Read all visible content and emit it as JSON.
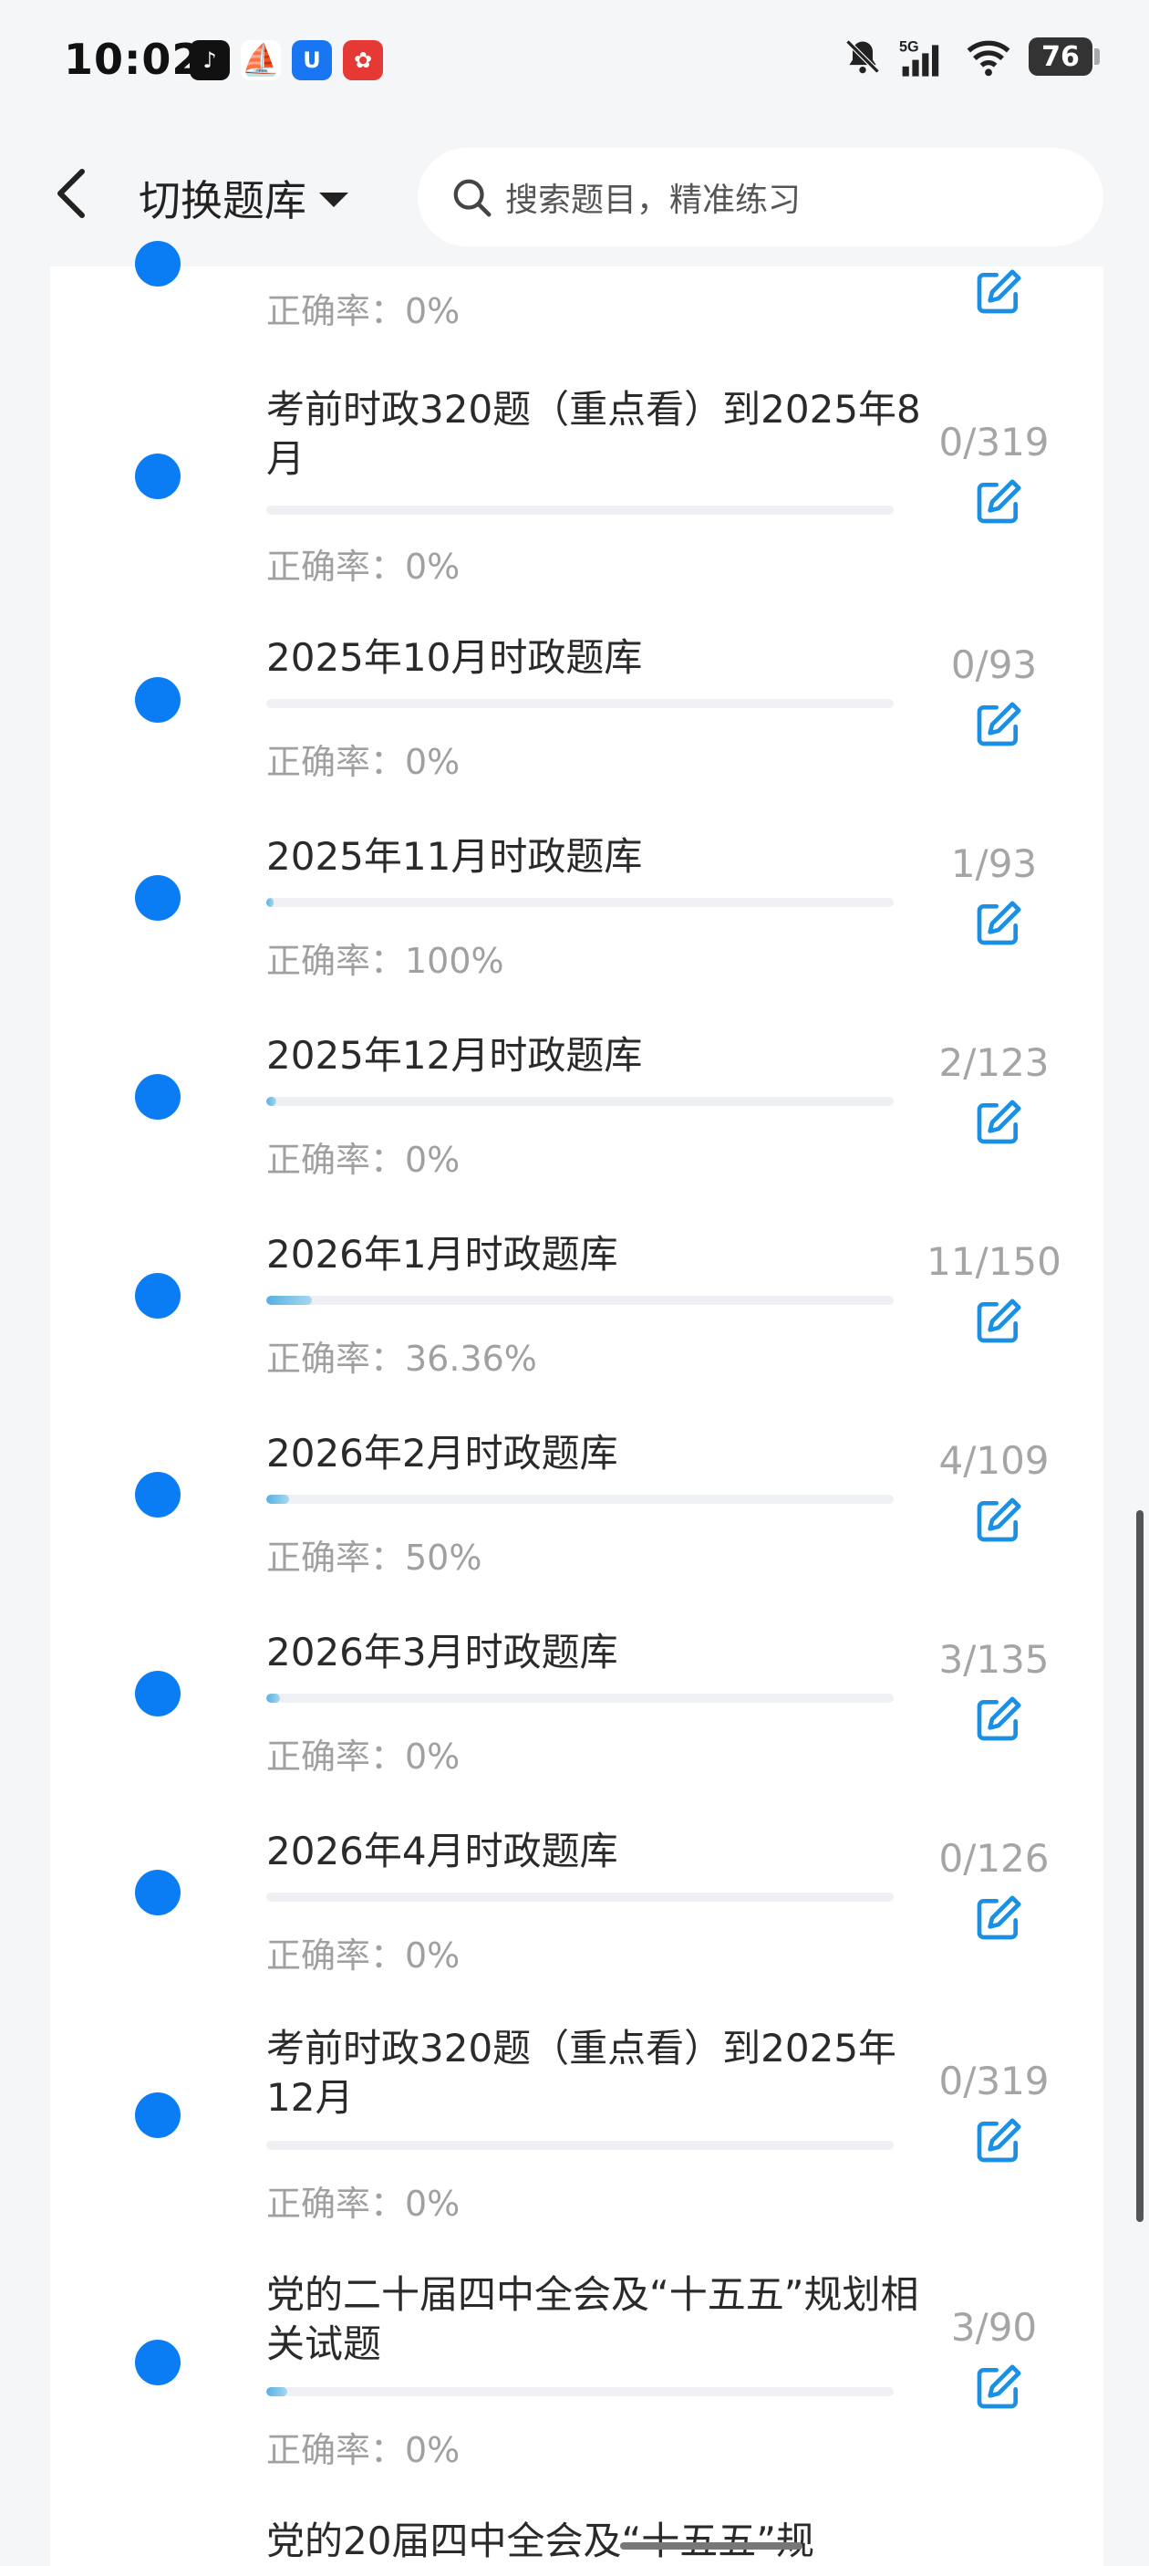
{
  "status": {
    "time": "10:02",
    "battery": "76",
    "network": "5G"
  },
  "header": {
    "switch_label": "切换题库",
    "search_placeholder": "搜索题目，精准练习"
  },
  "items": [
    {
      "title": "",
      "accuracy": "正确率：0%",
      "count": "",
      "progress": 0
    },
    {
      "title": "考前时政320题（重点看）到2025年8月",
      "accuracy": "正确率：0%",
      "count": "0/319",
      "progress": 0
    },
    {
      "title": "2025年10月时政题库",
      "accuracy": "正确率：0%",
      "count": "0/93",
      "progress": 0
    },
    {
      "title": "2025年11月时政题库",
      "accuracy": "正确率：100%",
      "count": "1/93",
      "progress": 0.011
    },
    {
      "title": "2025年12月时政题库",
      "accuracy": "正确率：0%",
      "count": "2/123",
      "progress": 0.016
    },
    {
      "title": "2026年1月时政题库",
      "accuracy": "正确率：36.36%",
      "count": "11/150",
      "progress": 0.073
    },
    {
      "title": "2026年2月时政题库",
      "accuracy": "正确率：50%",
      "count": "4/109",
      "progress": 0.037
    },
    {
      "title": "2026年3月时政题库",
      "accuracy": "正确率：0%",
      "count": "3/135",
      "progress": 0.022
    },
    {
      "title": "2026年4月时政题库",
      "accuracy": "正确率：0%",
      "count": "0/126",
      "progress": 0
    },
    {
      "title": "考前时政320题（重点看）到2025年12月",
      "accuracy": "正确率：0%",
      "count": "0/319",
      "progress": 0
    },
    {
      "title": "党的二十届四中全会及“十五五”规划相关试题",
      "accuracy": "正确率：0%",
      "count": "3/90",
      "progress": 0.033
    },
    {
      "title": "党的20届四中全会及“十五五”规",
      "accuracy": "",
      "count": "",
      "progress": 0
    }
  ],
  "colors": {
    "accent": "#0a7df5",
    "progress": "#56b0e0",
    "muted": "#a0a0a0"
  },
  "icons": {
    "back": "chevron-left-icon",
    "dropdown": "caret-down-icon",
    "search": "search-icon",
    "edit": "edit-icon",
    "dot": "status-dot-icon"
  }
}
